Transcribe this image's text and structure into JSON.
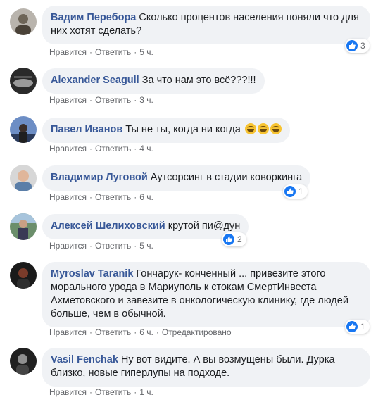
{
  "colors": {
    "author": "#385898",
    "bubble": "#f0f2f5",
    "meta": "#65676b",
    "like": "#1877f2"
  },
  "comments": [
    {
      "author": "Вадим Перебора",
      "text": "Сколько процентов населения поняли что для них хотят сделать?",
      "like_label": "Нравится",
      "reply_label": "Ответить",
      "time": "5 ч.",
      "reactions": "3",
      "avatar_icon": "user-avatar"
    },
    {
      "author": "Alexander Seagull",
      "text": "За что нам это всё???!!!",
      "like_label": "Нравится",
      "reply_label": "Ответить",
      "time": "3 ч.",
      "avatar_icon": "user-avatar"
    },
    {
      "author": "Павел Иванов",
      "text": "Ты не ты, когда ни когда",
      "emoji_icon": "laughing-emoji",
      "like_label": "Нравится",
      "reply_label": "Ответить",
      "time": "4 ч.",
      "avatar_icon": "user-avatar"
    },
    {
      "author": "Владимир Луговой",
      "text": "Аутсорсинг в стадии коворкинга",
      "like_label": "Нравится",
      "reply_label": "Ответить",
      "time": "6 ч.",
      "reactions": "1",
      "avatar_icon": "user-avatar"
    },
    {
      "author": "Алексей Шелиховский",
      "text": "крутой пи@дун",
      "like_label": "Нравится",
      "reply_label": "Ответить",
      "time": "5 ч.",
      "reactions": "2",
      "avatar_icon": "user-avatar"
    },
    {
      "author": "Myroslav Taranik",
      "text": "Гончарук- конченный ... привезите этого морального урода в Мариуполь к стокам СмертИнвеста Ахметовского и завезите в онкологическую клинику, где людей больше, чем в обычной.",
      "like_label": "Нравится",
      "reply_label": "Ответить",
      "time": "6 ч.",
      "edited": "Отредактировано",
      "reactions": "1",
      "avatar_icon": "user-avatar"
    },
    {
      "author": "Vasil Fenchak",
      "text": "Ну вот видите. А вы возмущены были. Дурка близко, новые гиперлупы на подходе.",
      "like_label": "Нравится",
      "reply_label": "Ответить",
      "time": "1 ч.",
      "avatar_icon": "user-avatar"
    }
  ]
}
